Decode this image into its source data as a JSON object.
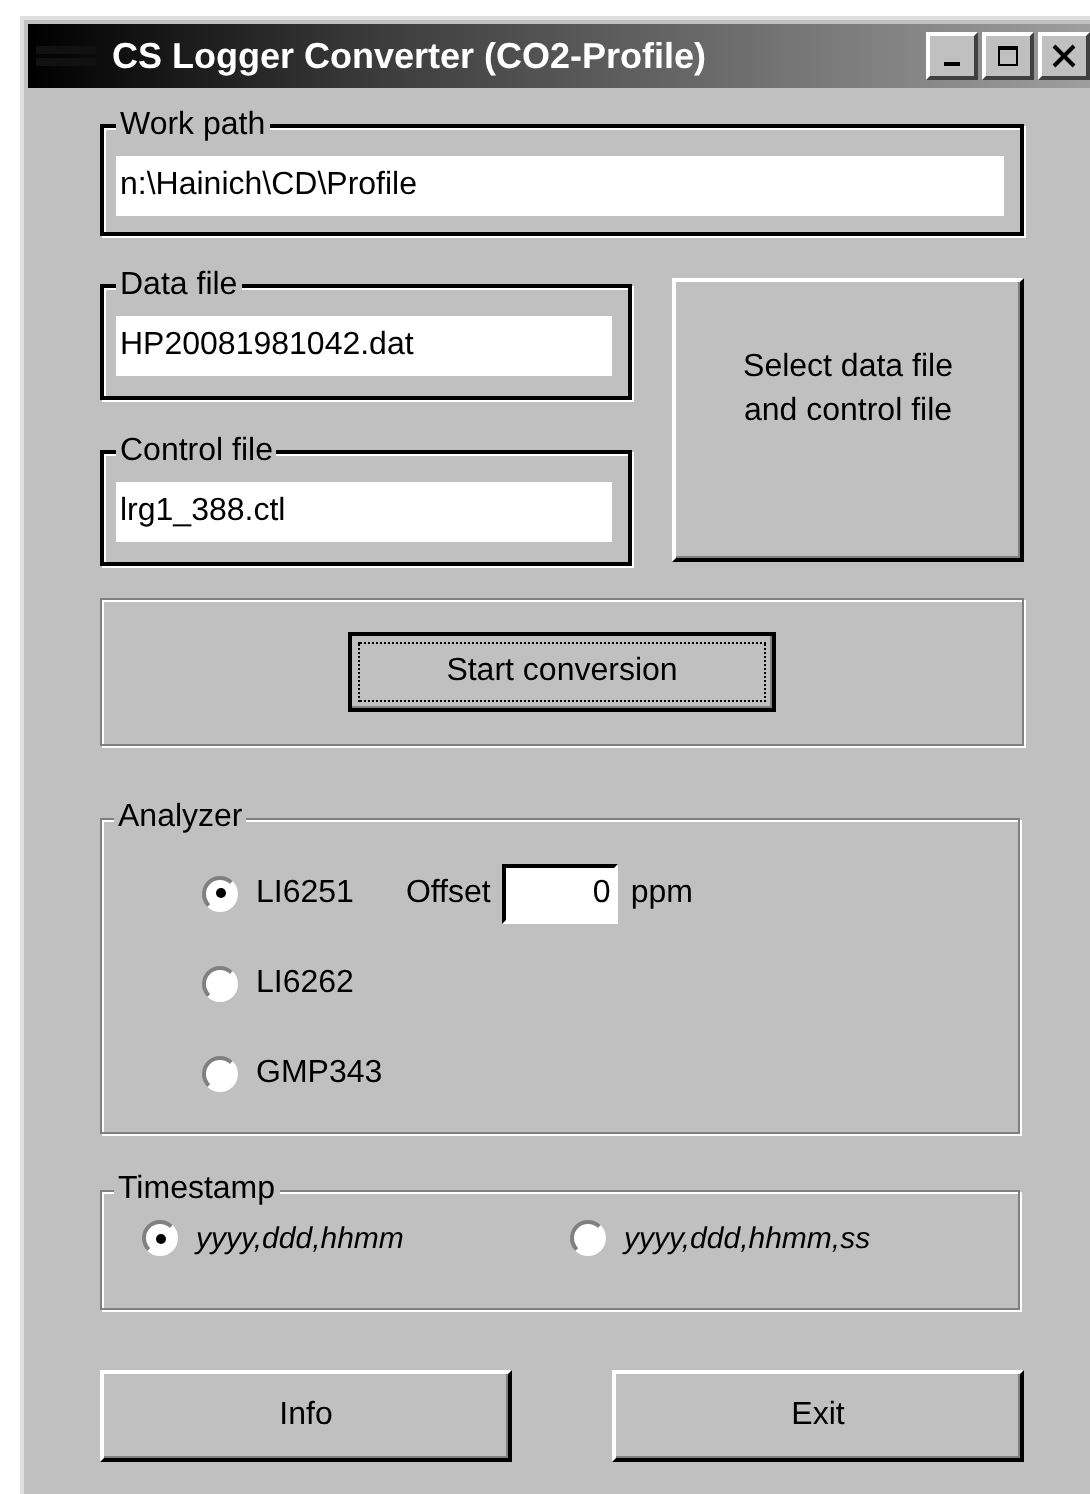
{
  "window": {
    "title": "CS Logger Converter (CO2-Profile)"
  },
  "work_path": {
    "label": "Work path",
    "value": "n:\\Hainich\\CD\\Profile"
  },
  "data_file": {
    "label": "Data file",
    "value": "HP20081981042.dat"
  },
  "control_file": {
    "label": "Control file",
    "value": "lrg1_388.ctl"
  },
  "select_button": "Select data file and control file",
  "start_button": "Start conversion",
  "analyzer": {
    "label": "Analyzer",
    "options": [
      {
        "label": "LI6251",
        "selected": true
      },
      {
        "label": "LI6262",
        "selected": false
      },
      {
        "label": "GMP343",
        "selected": false
      }
    ],
    "offset": {
      "label": "Offset",
      "value": "0",
      "unit": "ppm"
    }
  },
  "timestamp": {
    "label": "Timestamp",
    "options": [
      {
        "label": "yyyy,ddd,hhmm",
        "selected": true
      },
      {
        "label": "yyyy,ddd,hhmm,ss",
        "selected": false
      }
    ]
  },
  "buttons": [
    "Info",
    "Exit"
  ]
}
